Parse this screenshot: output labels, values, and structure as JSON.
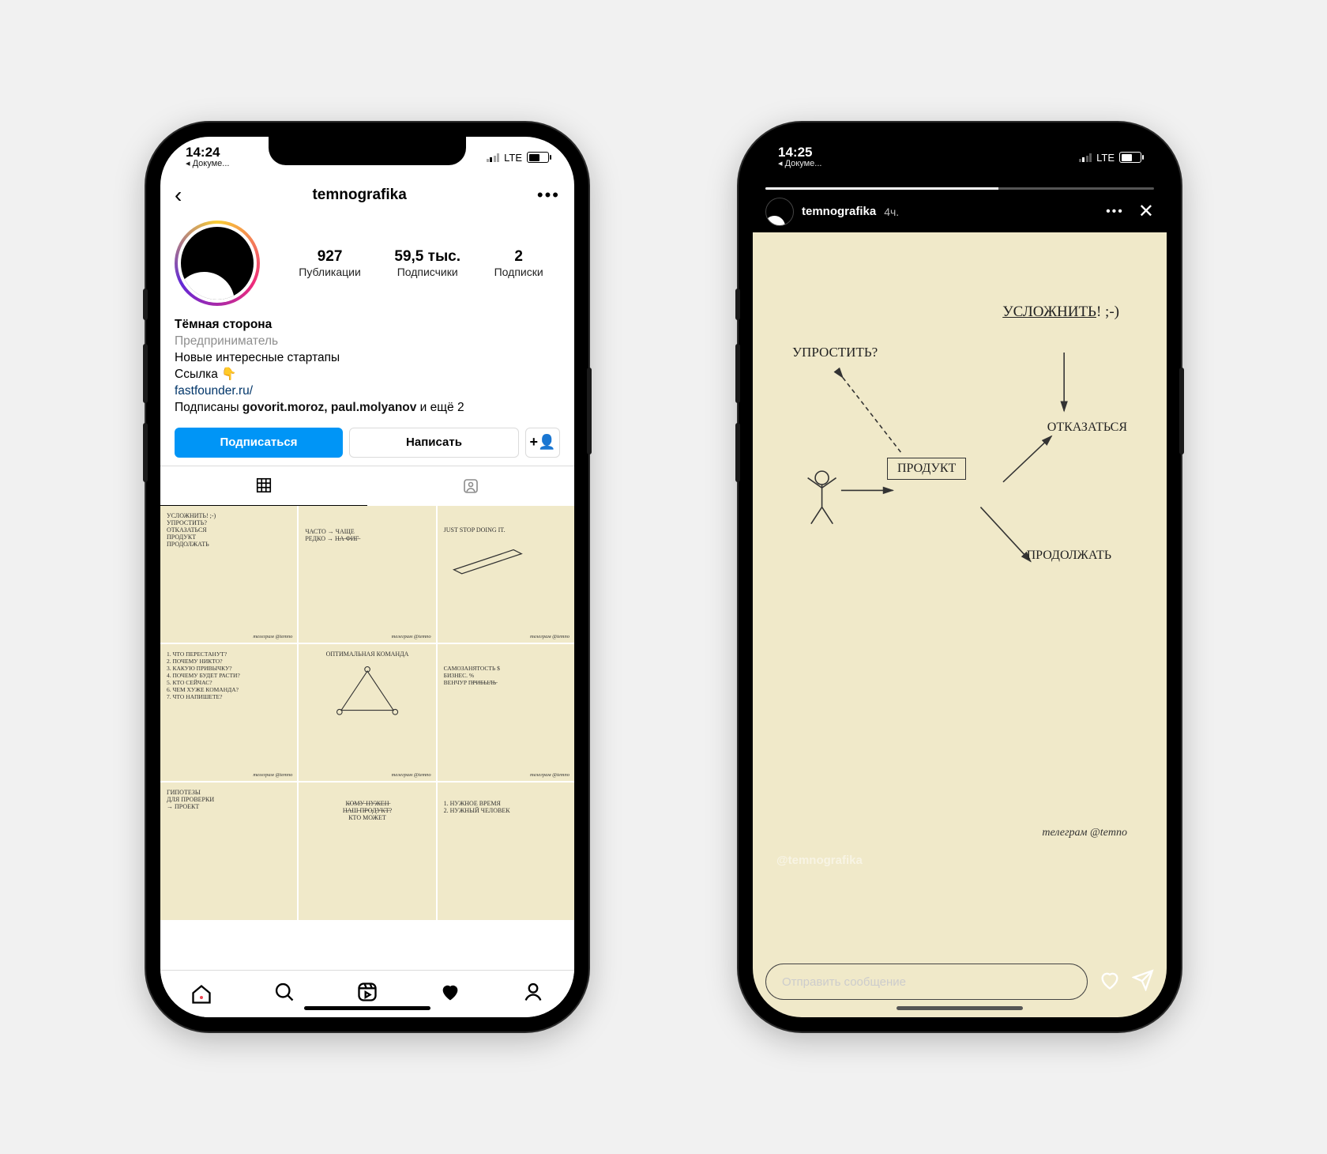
{
  "left": {
    "statusbar": {
      "time": "14:24",
      "back": "◂ Докуме...",
      "net": "LTE"
    },
    "nav": {
      "username": "temnografika"
    },
    "stats": {
      "posts": {
        "num": "927",
        "label": "Публикации"
      },
      "followers": {
        "num": "59,5 тыс.",
        "label": "Подписчики"
      },
      "following": {
        "num": "2",
        "label": "Подписки"
      }
    },
    "bio": {
      "title": "Тёмная сторона",
      "category": "Предприниматель",
      "line1": "Новые интересные стартапы",
      "line2": "Ссылка 👇",
      "link": "fastfounder.ru/",
      "followed_prefix": "Подписаны ",
      "followed_bold": "govorit.moroz, paul.molyanov",
      "followed_suffix": " и ещё 2"
    },
    "actions": {
      "follow": "Подписаться",
      "message": "Написать"
    },
    "grid_signature": "телеграм @temno",
    "cells": [
      "УСЛОЖНИТЬ! ;-)\nУПРОСТИТЬ?\nОТКАЗАТЬСЯ\nПРОДУКТ\nПРОДОЛЖАТЬ",
      "ЧАСТО → ЧАЩЕ\nРЕДКО → Н̶А̶ ̶Ф̶И̶Г̶",
      "JUST STOP DOING IT.",
      "1. ЧТО ПЕРЕСТАНУТ?\n2. ПОЧЕМУ НИКТО?\n3. КАКУЮ ПРИВЫЧКУ?\n4. ПОЧЕМУ БУДЕТ РАСТИ?\n5. КТО СЕЙЧАС?\n6. ЧЕМ ХУЖЕ КОМАНДА?\n7. ЧТО НАПИШЕТЕ?",
      "ОПТИМАЛЬНАЯ КОМАНДА",
      "САМОЗАНЯТОСТЬ  $\nБИЗНЕС.        %\nВЕНЧУР     П̶Р̶И̶Б̶Ы̶Л̶Ь̶",
      "ГИПОТЕЗЫ\nДЛЯ ПРОВЕРКИ\n→ ПРОЕКТ",
      "К̶О̶М̶У̶ ̶Н̶У̶Ж̶Е̶Н̶\nН̶А̶Ш̶ ̶П̶Р̶О̶Д̶У̶К̶Т̶?\nКТО МОЖЕТ",
      "1. НУЖНОЕ ВРЕМЯ\n2. НУЖНЫЙ ЧЕЛОВЕК"
    ]
  },
  "right": {
    "statusbar": {
      "time": "14:25",
      "back": "◂ Докуме...",
      "net": "LTE"
    },
    "head": {
      "user": "temnografika",
      "time": "4ч."
    },
    "sketch": {
      "t1": "УСЛОЖНИТЬ",
      "t1_tail": "! ;-)",
      "t2": "УПРОСТИТЬ?",
      "t3": "ОТКАЗАТЬСЯ",
      "box": "ПРОДУКТ",
      "t4": "ПРОДОЛЖАТЬ",
      "signature": "телеграм @temno"
    },
    "mention": "@temnografika",
    "reply_placeholder": "Отправить сообщение"
  }
}
